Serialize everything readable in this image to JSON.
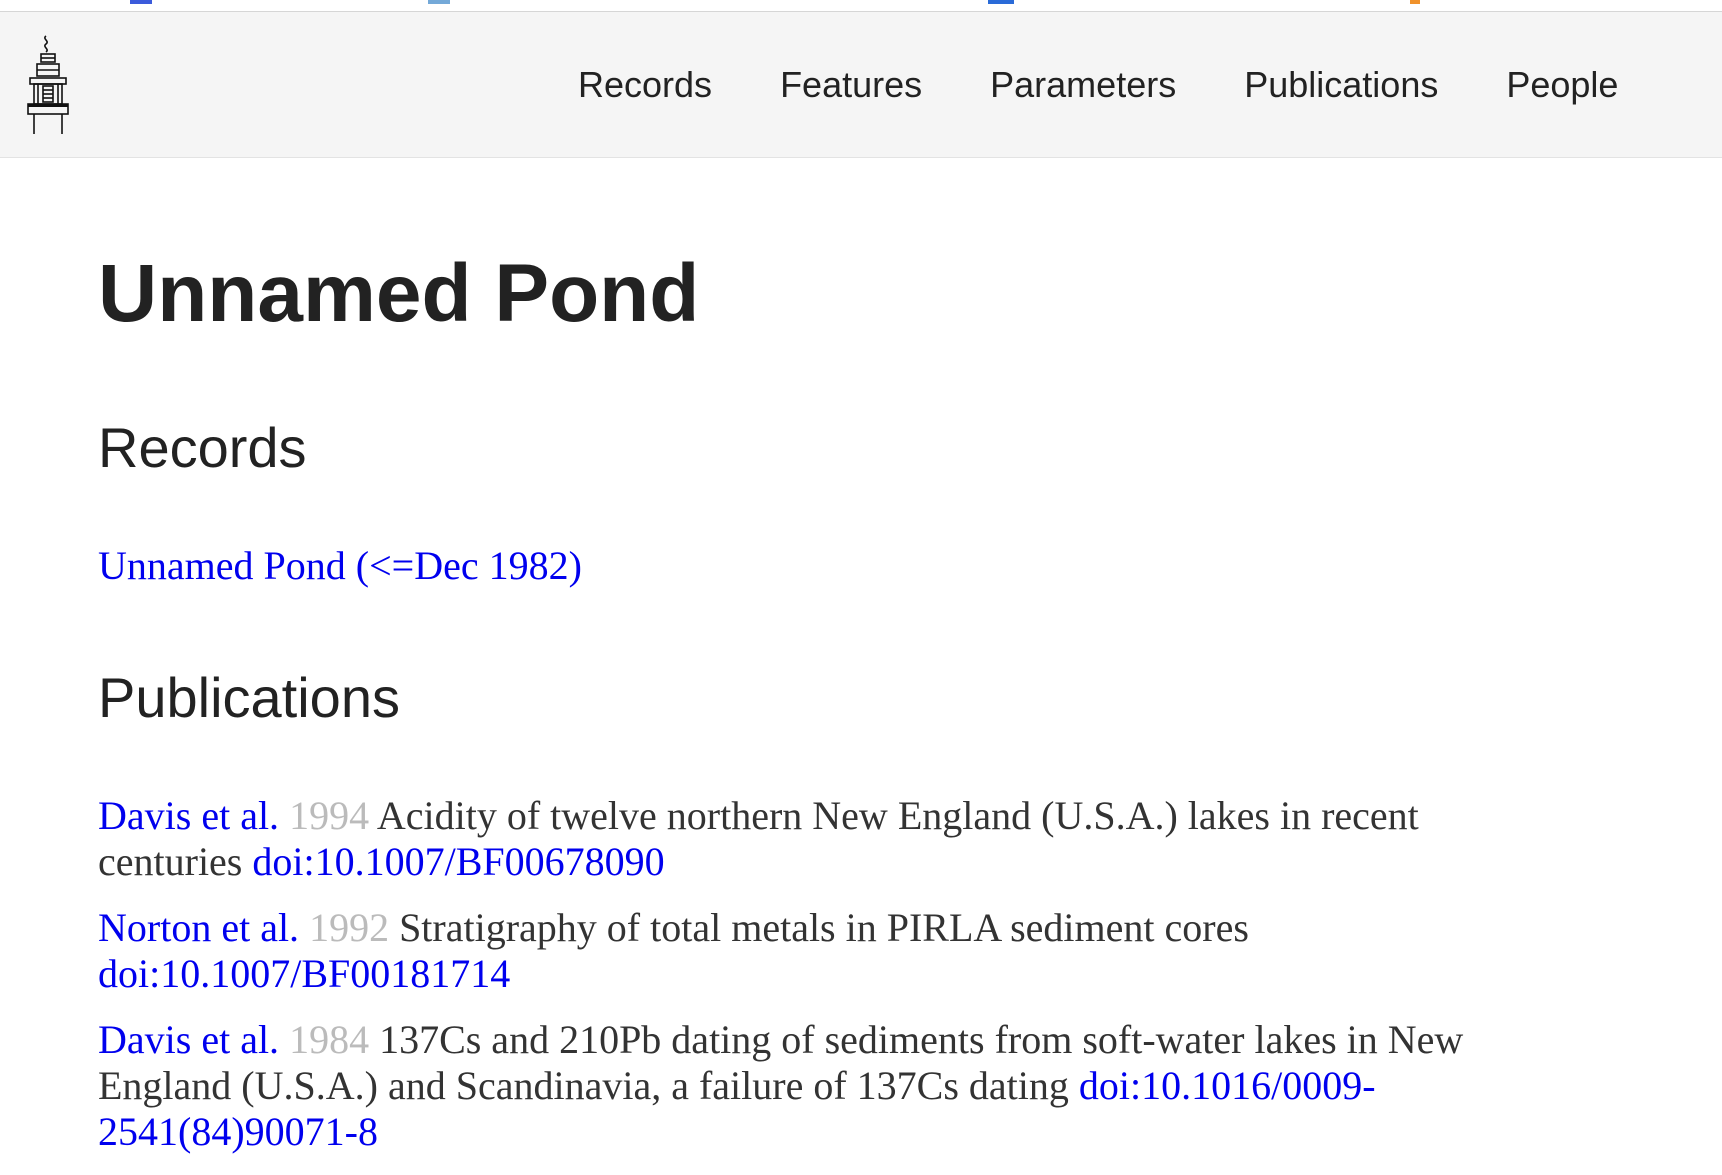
{
  "nav": {
    "logo_icon": "sediment-core-sampler-icon",
    "links": [
      "Records",
      "Features",
      "Parameters",
      "Publications",
      "People"
    ]
  },
  "page": {
    "title": "Unnamed Pond",
    "records_heading": "Records",
    "publications_heading": "Publications"
  },
  "records": [
    {
      "label": "Unnamed Pond (<=Dec 1982)"
    }
  ],
  "publications": [
    {
      "authors": "Davis et al.",
      "year": "1994",
      "title": "Acidity of twelve northern New England (U.S.A.) lakes in recent centuries",
      "doi": "doi:10.1007/BF00678090"
    },
    {
      "authors": "Norton et al.",
      "year": "1992",
      "title": "Stratigraphy of total metals in PIRLA sediment cores",
      "doi": "doi:10.1007/BF00181714"
    },
    {
      "authors": "Davis et al.",
      "year": "1984",
      "title": "137Cs and 210Pb dating of sediments from soft-water lakes in New England (U.S.A.) and Scandinavia, a failure of 137Cs dating",
      "doi": "doi:10.1016/0009-2541(84)90071-8"
    }
  ],
  "colors": {
    "link": "#0000ee",
    "year": "#bbbbbb",
    "navbar_bg": "#f5f5f5",
    "text": "#222222"
  }
}
